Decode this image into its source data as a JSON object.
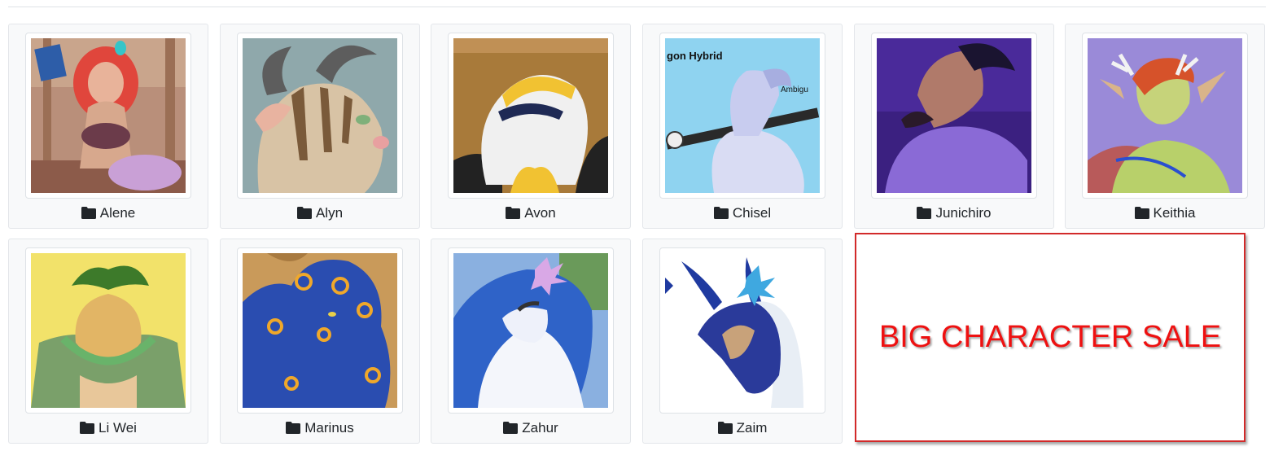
{
  "gallery": {
    "folders": [
      {
        "name": "Alene"
      },
      {
        "name": "Alyn"
      },
      {
        "name": "Avon"
      },
      {
        "name": "Chisel"
      },
      {
        "name": "Junichiro"
      },
      {
        "name": "Keithia"
      },
      {
        "name": "Li Wei"
      },
      {
        "name": "Marinus"
      },
      {
        "name": "Zahur"
      },
      {
        "name": "Zaim"
      }
    ],
    "thumbnail_text": {
      "chisel_label": "gon Hybrid",
      "chisel_side": "Ambigu"
    }
  },
  "banner": {
    "text": "BIG CHARACTER SALE",
    "text_color": "#ee1111",
    "border_color": "#d22a2a"
  },
  "colors": {
    "card_bg": "#f8f9fa",
    "card_border": "#e3e6ea",
    "folder_icon": "#212529"
  }
}
